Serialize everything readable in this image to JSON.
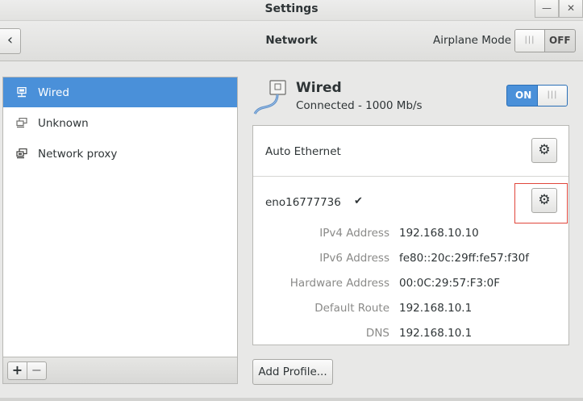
{
  "window": {
    "title": "Settings"
  },
  "header": {
    "title": "Network",
    "airplane_mode_label": "Airplane Mode",
    "airplane_mode_state": "OFF"
  },
  "sidebar": {
    "items": [
      {
        "label": "Wired",
        "icon": "wired-network-icon",
        "selected": true
      },
      {
        "label": "Unknown",
        "icon": "unknown-network-icon",
        "selected": false
      },
      {
        "label": "Network proxy",
        "icon": "network-proxy-icon",
        "selected": false
      }
    ],
    "add_label": "+",
    "remove_label": "−"
  },
  "device": {
    "name": "Wired",
    "status": "Connected - 1000 Mb/s",
    "switch_state": "ON"
  },
  "profiles": {
    "auto_profile_name": "Auto Ethernet",
    "interface_name": "eno16777736",
    "active_mark": "✔",
    "properties": [
      {
        "label": "IPv4 Address",
        "value": "192.168.10.10"
      },
      {
        "label": "IPv6 Address",
        "value": "fe80::20c:29ff:fe57:f30f"
      },
      {
        "label": "Hardware Address",
        "value": "00:0C:29:57:F3:0F"
      },
      {
        "label": "Default Route",
        "value": "192.168.10.1"
      },
      {
        "label": "DNS",
        "value": "192.168.10.1"
      }
    ]
  },
  "actions": {
    "add_profile_label": "Add Profile..."
  },
  "colors": {
    "accent": "#4a90d9",
    "highlight_box": "#e0463b"
  }
}
